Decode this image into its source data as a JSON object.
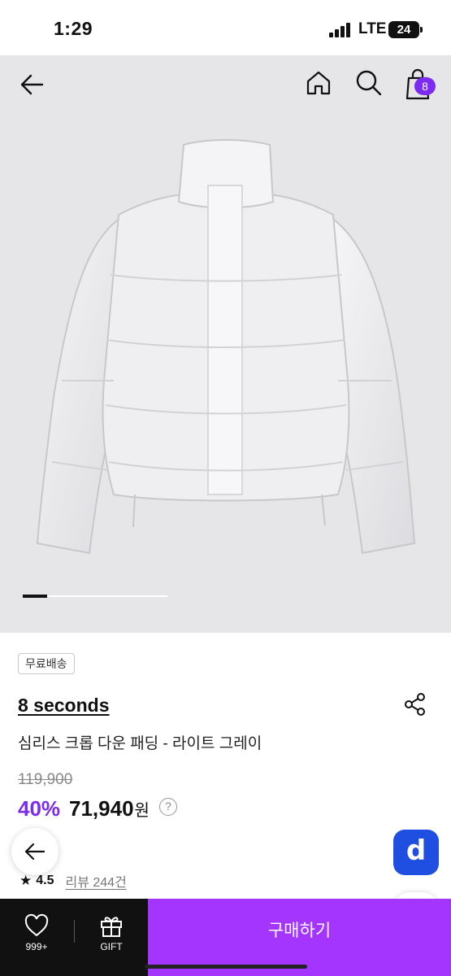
{
  "status_bar": {
    "time": "1:29",
    "network": "LTE",
    "battery": "24"
  },
  "nav": {
    "cart_count": "8"
  },
  "gallery": {
    "current_index": 1
  },
  "product": {
    "shipping_badge": "무료배송",
    "brand": "8 seconds",
    "name": "심리스 크롭 다운 패딩 - 라이트 그레이",
    "original_price": "119,900",
    "discount": "40%",
    "price": "71,940",
    "currency": "원",
    "info_symbol": "?",
    "rating": "4.5",
    "reviews": "리뷰 244건"
  },
  "floating": {
    "app_badge": "d"
  },
  "bottom_bar": {
    "like_count": "999+",
    "gift_label": "GIFT",
    "buy_label": "구매하기"
  },
  "colors": {
    "accent_purple": "#7b2cf0",
    "buy_button": "#a335ff",
    "app_badge_blue": "#1f4fe0",
    "bottom_bar": "#111111",
    "hero_background": "#e6e6e9"
  }
}
